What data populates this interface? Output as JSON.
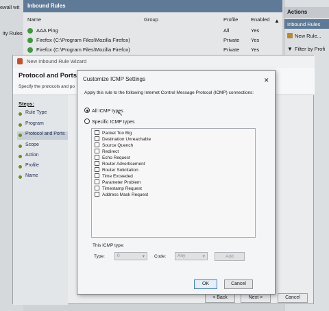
{
  "console": {
    "tree_title": "ewall wit",
    "tree_item": "ity Rules",
    "pane_title": "Inbound Rules",
    "columns": [
      "Name",
      "Group",
      "Profile",
      "Enabled"
    ],
    "rules": [
      {
        "name": "AAA Ping",
        "profile": "All",
        "enabled": "Yes"
      },
      {
        "name": "Firefox (C:\\Program Files\\Mozilla Firefox)",
        "profile": "Private",
        "enabled": "Yes"
      },
      {
        "name": "Firefox (C:\\Program Files\\Mozilla Firefox)",
        "profile": "Private",
        "enabled": "Yes"
      }
    ],
    "actions_title": "Actions",
    "actions_selected": "Inbound Rules",
    "actions": [
      "New Rule...",
      "Filter by Profi"
    ]
  },
  "wizard": {
    "title": "New Inbound Rule Wizard",
    "heading": "Protocol and Ports",
    "subheading": "Specify the protocols and po",
    "steps_label": "Steps:",
    "steps": [
      "Rule Type",
      "Program",
      "Protocol and Ports",
      "Scope",
      "Action",
      "Profile",
      "Name"
    ],
    "current_step": 2,
    "back_label": "< Back",
    "next_label": "Next >",
    "cancel_label": "Cancel"
  },
  "icmp": {
    "title": "Customize ICMP Settings",
    "close": "✕",
    "description": "Apply this rule to the following Internet Control Message Protocol (ICMP) connections:",
    "radio_all": "All ICMP types",
    "radio_specific": "Specific ICMP types",
    "types": [
      "Packet Too Big",
      "Destination Unreachable",
      "Source Quench",
      "Redirect",
      "Echo Request",
      "Router Advertisement",
      "Router Solicitation",
      "Time Exceeded",
      "Parameter Problem",
      "Timestamp Request",
      "Address Mask Request"
    ],
    "this_type_label": "This ICMP type:",
    "type_label": "Type:",
    "type_value": "0",
    "code_label": "Code:",
    "code_value": "Any",
    "add_label": "Add",
    "ok_label": "OK",
    "cancel_label": "Cancel"
  }
}
